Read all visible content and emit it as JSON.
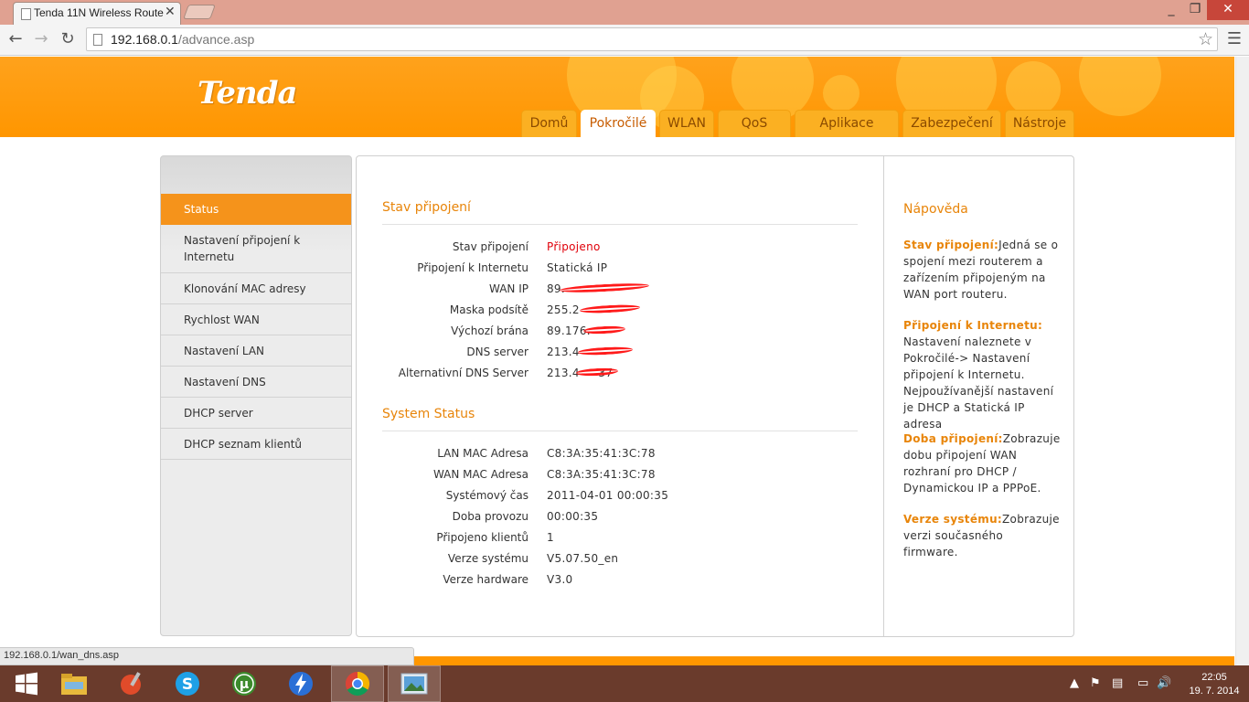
{
  "browser": {
    "tab_title": "Tenda 11N Wireless Route",
    "url_host": "192.168.0.1",
    "url_path": "/advance.asp",
    "status_url": "192.168.0.1/wan_dns.asp",
    "window_buttons": {
      "minimize": "_",
      "maximize": "❐",
      "close": "✕"
    },
    "tab_close": "✕",
    "icons": {
      "back": "arrow-left-icon",
      "forward": "arrow-right-icon",
      "reload": "reload-icon",
      "bookmark": "star-icon",
      "menu": "hamburger-menu-icon"
    }
  },
  "router": {
    "logo": "Tenda",
    "nav_tabs": [
      {
        "label": "Domů"
      },
      {
        "label": "Pokročilé"
      },
      {
        "label": "WLAN"
      },
      {
        "label": "QoS"
      },
      {
        "label": "Aplikace"
      },
      {
        "label": "Zabezpečení"
      },
      {
        "label": "Nástroje"
      }
    ],
    "active_tab": "Pokročilé",
    "sidebar": [
      {
        "label": "Status"
      },
      {
        "label": "Nastavení připojení k Internetu"
      },
      {
        "label": "Klonování MAC adresy"
      },
      {
        "label": "Rychlost WAN"
      },
      {
        "label": "Nastavení LAN"
      },
      {
        "label": "Nastavení DNS"
      },
      {
        "label": "DHCP server"
      },
      {
        "label": "DHCP seznam klientů"
      }
    ],
    "connection": {
      "title": "Stav připojení",
      "rows": [
        {
          "label": "Stav připojení",
          "value": "Připojeno"
        },
        {
          "label": "Připojení k Internetu",
          "value": "Statická IP"
        },
        {
          "label": "WAN IP",
          "value": "89."
        },
        {
          "label": "Maska podsítě",
          "value": "255.2"
        },
        {
          "label": "Výchozí brána",
          "value": "89.176."
        },
        {
          "label": "DNS server",
          "value": "213.4"
        },
        {
          "label": "Alternativní DNS Server",
          "value": "213.4     37"
        }
      ]
    },
    "system": {
      "title": "System Status",
      "rows": [
        {
          "label": "LAN MAC Adresa",
          "value": "C8:3A:35:41:3C:78"
        },
        {
          "label": "WAN MAC Adresa",
          "value": "C8:3A:35:41:3C:78"
        },
        {
          "label": "Systémový čas",
          "value": "2011-04-01 00:00:35"
        },
        {
          "label": "Doba provozu",
          "value": "00:00:35"
        },
        {
          "label": "Připojeno klientů",
          "value": "1"
        },
        {
          "label": "Verze systému",
          "value": "V5.07.50_en"
        },
        {
          "label": "Verze hardware",
          "value": "V3.0"
        }
      ]
    },
    "help": {
      "title": "Nápověda",
      "items": [
        {
          "term": "Stav připojení:",
          "text": "Jedná se o spojení mezi routerem a zařízením připojeným na WAN port routeru."
        },
        {
          "term": "Připojení k Internetu:",
          "text": "Nastavení naleznete v Pokročilé-> Nastavení připojení k Internetu. Nejpoužívanější nastavení je DHCP a Statická IP adresa"
        },
        {
          "term": "Doba připojení:",
          "text": "Zobrazuje dobu připojení WAN rozhraní pro DHCP / Dynamickou IP a PPPoE."
        },
        {
          "term": "Verze systému:",
          "text": "Zobrazuje verzi současného firmware."
        }
      ]
    }
  },
  "taskbar": {
    "apps": [
      "start-windows-icon",
      "file-explorer-icon",
      "ccleaner-icon",
      "skype-icon",
      "utorrent-icon",
      "flashget-icon",
      "chrome-icon",
      "photo-viewer-icon"
    ],
    "tray": [
      "chevron-up-icon",
      "flag-icon",
      "network-icon",
      "battery-icon",
      "volume-icon"
    ],
    "time": "22:05",
    "date": "19. 7. 2014"
  }
}
